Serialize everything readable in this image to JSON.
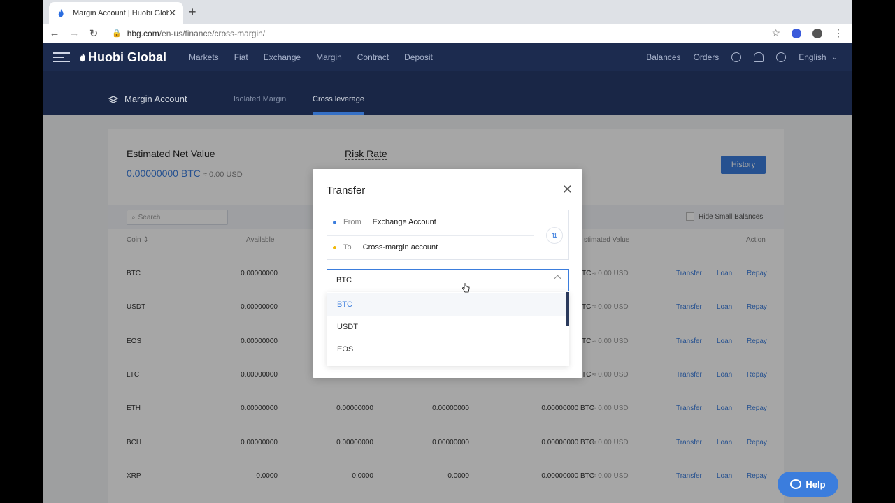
{
  "browser": {
    "tab_title": "Margin Account | Huobi Global",
    "tab_close": "✕",
    "new_tab": "+",
    "url_domain": "hbg.com",
    "url_path": "/en-us/finance/cross-margin/"
  },
  "site_nav": {
    "logo": "Huobi Global",
    "links": [
      "Markets",
      "Fiat",
      "Exchange",
      "Margin",
      "Contract",
      "Deposit"
    ],
    "balances": "Balances",
    "orders": "Orders",
    "language": "English"
  },
  "sub_header": {
    "title": "Margin Account",
    "tabs": [
      "Isolated Margin",
      "Cross leverage"
    ],
    "active_tab": "Cross leverage"
  },
  "summary": {
    "estimated_net_value_label": "Estimated Net Value",
    "estimated_net_value": "0.00000000 BTC",
    "estimated_net_value_usd": "≈ 0.00 USD",
    "risk_rate_label": "Risk Rate",
    "history_button": "History"
  },
  "filters": {
    "search_placeholder": "Search",
    "hide_small_balances": "Hide Small Balances"
  },
  "table": {
    "headers": {
      "coin": "Coin",
      "available": "Available",
      "estimated_value": "stimated Value",
      "action": "Action"
    },
    "rows": [
      {
        "coin": "BTC",
        "available": "0.00000000",
        "col2": "",
        "col3": "",
        "est": "",
        "est_partial": "TC",
        "usd": "≈ 0.00 USD"
      },
      {
        "coin": "USDT",
        "available": "0.00000000",
        "col2": "",
        "col3": "",
        "est": "",
        "est_partial": "TC",
        "usd": "≈ 0.00 USD"
      },
      {
        "coin": "EOS",
        "available": "0.00000000",
        "col2": "",
        "col3": "",
        "est": "",
        "est_partial": "TC",
        "usd": "≈ 0.00 USD"
      },
      {
        "coin": "LTC",
        "available": "0.00000000",
        "col2": "",
        "col3": "",
        "est": "",
        "est_partial": "TC",
        "usd": "≈ 0.00 USD"
      },
      {
        "coin": "ETH",
        "available": "0.00000000",
        "col2": "0.00000000",
        "col3": "0.00000000",
        "est": "0.00000000 BTC",
        "est_partial": "",
        "usd": "≈ 0.00 USD"
      },
      {
        "coin": "BCH",
        "available": "0.00000000",
        "col2": "0.00000000",
        "col3": "0.00000000",
        "est": "0.00000000 BTC",
        "est_partial": "",
        "usd": "≈ 0.00 USD"
      },
      {
        "coin": "XRP",
        "available": "0.0000",
        "col2": "0.0000",
        "col3": "0.0000",
        "est": "0.00000000 BTC",
        "est_partial": "",
        "usd": "≈ 0.00 USD"
      }
    ],
    "actions": [
      "Transfer",
      "Loan",
      "Repay"
    ]
  },
  "modal": {
    "title": "Transfer",
    "from_label": "From",
    "from_value": "Exchange Account",
    "to_label": "To",
    "to_value": "Cross-margin account",
    "selected_coin": "BTC",
    "options": [
      "BTC",
      "USDT",
      "EOS"
    ]
  },
  "help_button": "Help",
  "colors": {
    "nav_bg": "#1c2b4f",
    "accent": "#3b7ddd",
    "from_dot": "#3b7ddd",
    "to_dot": "#f0b90b"
  },
  "icons": [
    "search-icon",
    "swap-icon",
    "close-icon",
    "chevron-up-icon",
    "user-icon",
    "bell-icon",
    "download-icon",
    "help-chat-icon"
  ]
}
